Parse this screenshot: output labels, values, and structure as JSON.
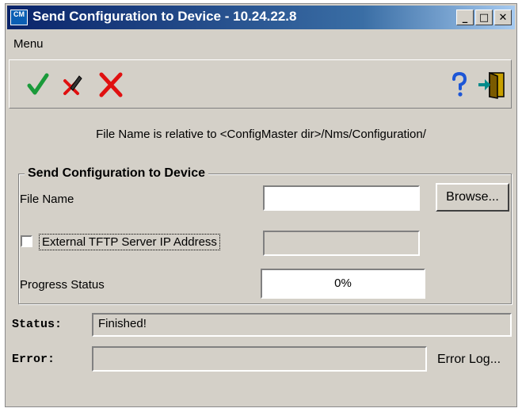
{
  "window": {
    "title": "Send Configuration to Device - 10.24.22.8",
    "app_icon_text": "CM",
    "controls": {
      "minimize": "_",
      "maximize": "□",
      "close": "✕"
    }
  },
  "menu": {
    "label": "Menu"
  },
  "toolbar": {
    "icons": [
      "check-icon",
      "pen-cross-icon",
      "red-x-icon",
      "help-icon",
      "exit-door-icon"
    ],
    "colors": {
      "check": "#1a9a3a",
      "red": "#e01010",
      "help": "#1d56d6"
    }
  },
  "note": "File Name is relative to <ConfigMaster dir>/Nms/Configuration/",
  "group": {
    "title": "Send Configuration to Device",
    "file_name_label": "File Name",
    "file_name_value": "",
    "browse_label": "Browse...",
    "tftp_label": "External TFTP Server IP Address",
    "tftp_checked": false,
    "tftp_value": "",
    "progress_label": "Progress Status",
    "progress_value": "0%"
  },
  "status": {
    "label": "Status:",
    "value": "Finished!"
  },
  "error": {
    "label": "Error:",
    "value": "",
    "log_label": "Error Log..."
  }
}
